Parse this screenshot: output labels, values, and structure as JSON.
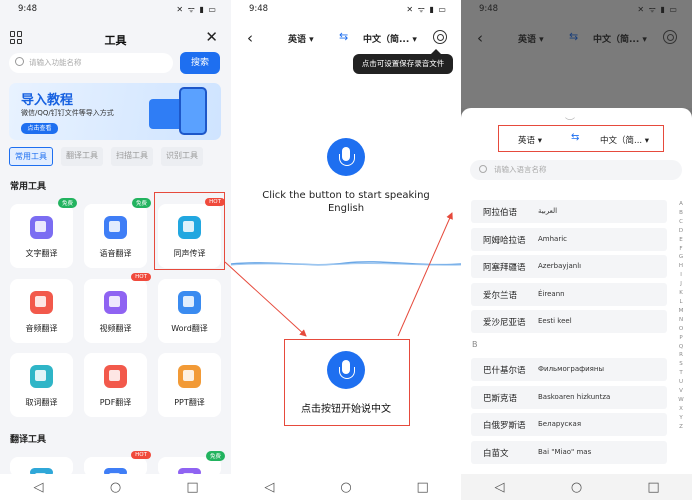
{
  "status": {
    "time": "9:48",
    "icons": "✕ ᯤ ▮ ▭"
  },
  "panel1": {
    "title": "工具",
    "search_placeholder": "请输入功能名称",
    "search_button": "搜索",
    "banner": {
      "title": "导入教程",
      "subtitle": "微信/QQ/钉钉文件等导入方式",
      "button": "点击查看"
    },
    "tabs": [
      "常用工具",
      "翻译工具",
      "扫描工具",
      "识别工具"
    ],
    "section_common": "常用工具",
    "section_translate": "翻译工具",
    "tools": [
      {
        "label": "文字翻译",
        "badge": "免费",
        "badge_type": "free",
        "color": "#7b6df2"
      },
      {
        "label": "语音翻译",
        "badge": "免费",
        "badge_type": "free",
        "color": "#3f7ef6"
      },
      {
        "label": "同声传译",
        "badge": "HOT",
        "badge_type": "hot",
        "color": "#22a7e0"
      },
      {
        "label": "音频翻译",
        "badge": "",
        "badge_type": "",
        "color": "#f2594b"
      },
      {
        "label": "视频翻译",
        "badge": "HOT",
        "badge_type": "hot",
        "color": "#8f63f2"
      },
      {
        "label": "Word翻译",
        "badge": "",
        "badge_type": "",
        "color": "#3a8bf0"
      },
      {
        "label": "取词翻译",
        "badge": "",
        "badge_type": "",
        "color": "#2fb5c7"
      },
      {
        "label": "PDF翻译",
        "badge": "",
        "badge_type": "",
        "color": "#f2594b"
      },
      {
        "label": "PPT翻译",
        "badge": "",
        "badge_type": "",
        "color": "#f29a36"
      }
    ],
    "bottom_badges": [
      {
        "label": "HOT",
        "type": "hot"
      },
      {
        "label": "免费",
        "type": "free"
      }
    ]
  },
  "panel2": {
    "source_lang": "英语",
    "target_lang": "中文（简...",
    "tooltip": "点击可设置保存录音文件",
    "hint_en": "Click the button to start speaking English",
    "hint_zh": "点击按钮开始说中文"
  },
  "panel3": {
    "source_lang": "英语",
    "target_lang": "中文（简...",
    "search_placeholder": "请输入语言名称",
    "group_b": "B",
    "languages_a": [
      {
        "name": "阿拉伯语",
        "native": "العربية"
      },
      {
        "name": "阿姆哈拉语",
        "native": "Amharic"
      },
      {
        "name": "阿塞拜疆语",
        "native": "Azerbayjanlı"
      },
      {
        "name": "爱尔兰语",
        "native": "Éireann"
      },
      {
        "name": "爱沙尼亚语",
        "native": "Eesti keel"
      }
    ],
    "languages_b": [
      {
        "name": "巴什基尔语",
        "native": "Фильмографияны"
      },
      {
        "name": "巴斯克语",
        "native": "Baskoaren hizkuntza"
      },
      {
        "name": "白俄罗斯语",
        "native": "Беларуская"
      },
      {
        "name": "白苗文",
        "native": "Bai \"Miao\" mas"
      }
    ],
    "index": [
      "A",
      "B",
      "C",
      "D",
      "E",
      "F",
      "G",
      "H",
      "I",
      "J",
      "K",
      "L",
      "M",
      "N",
      "O",
      "P",
      "Q",
      "R",
      "S",
      "T",
      "U",
      "V",
      "W",
      "X",
      "Y",
      "Z"
    ]
  }
}
